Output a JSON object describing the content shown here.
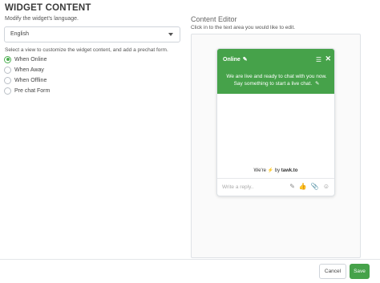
{
  "page": {
    "heading": "WIDGET CONTENT",
    "language_prompt": "Modify the widget's language."
  },
  "language_select": {
    "value": "English"
  },
  "views": {
    "prompt": "Select a view to customize the widget content, and add a prechat form.",
    "options": [
      {
        "label": "When Online",
        "checked": true
      },
      {
        "label": "When Away",
        "checked": false
      },
      {
        "label": "When Offline",
        "checked": false
      },
      {
        "label": "Pre chat Form",
        "checked": false
      }
    ]
  },
  "editor": {
    "title": "Content Editor",
    "subtitle": "Click in to the text area you would like to edit."
  },
  "widget": {
    "status": "Online",
    "message": "We are live and ready to chat with you now. Say something to start a live chat.",
    "footer_prefix": "We're",
    "footer_by": "by",
    "footer_brand": "tawk.to",
    "reply_placeholder": "Write a reply..",
    "header_color": "#46a24a",
    "icons": [
      "menu-icon",
      "close-icon",
      "pencil-icon",
      "attach-icon",
      "thumbs-up-icon",
      "paperclip-icon",
      "emoji-icon"
    ]
  },
  "actions": {
    "cancel_label": "Cancel",
    "save_label": "Save"
  },
  "colors": {
    "accent": "#46a24a",
    "radio_checked": "#4caf50"
  }
}
